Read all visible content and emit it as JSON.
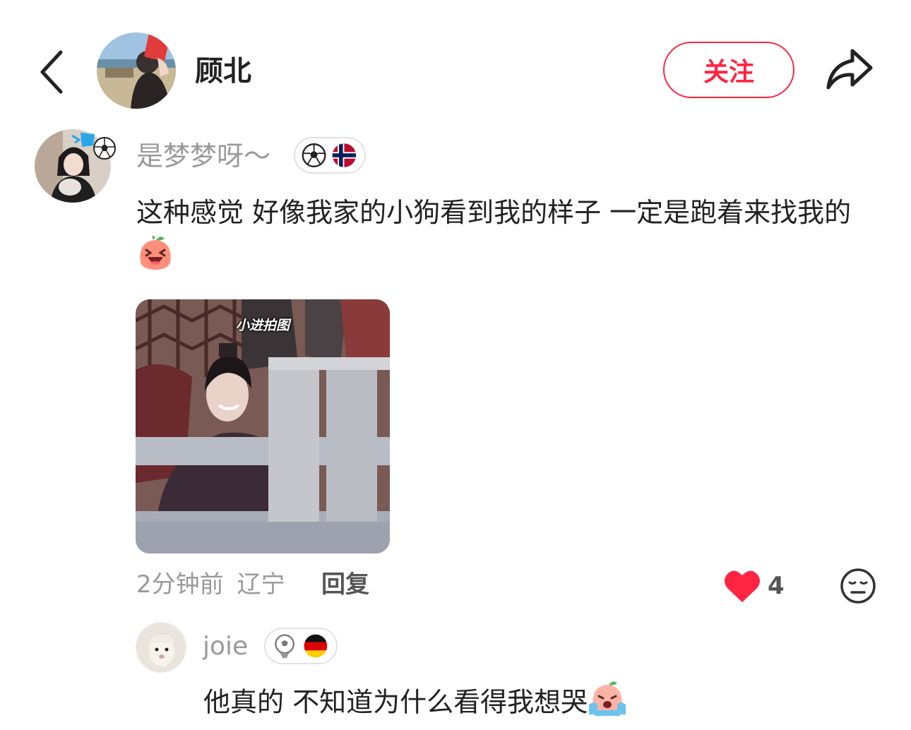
{
  "header": {
    "author_name": "顾北",
    "follow_label": "关注",
    "icons": {
      "back": "chevron-left-icon",
      "share": "share-arrow-icon"
    }
  },
  "comment": {
    "user_name": "是梦梦呀～",
    "text": "这种感觉 好像我家的小狗看到我的样子 一定是跑着来找我的",
    "text_emoji": "laughing-face-emoji",
    "badge_icons": [
      "soccer-ball-icon",
      "norway-flag-icon"
    ],
    "image_caption": "小进拍图",
    "time": "2分钟前",
    "location": "辽宁",
    "reply_label": "回复",
    "like_count": "4",
    "liked": true
  },
  "reply": {
    "user_name": "joie",
    "badge_icons": [
      "soccer-ball-icon",
      "germany-flag-icon"
    ],
    "text": "他真的 不知道为什么看得我想哭",
    "text_emoji": "crying-face-emoji"
  },
  "colors": {
    "accent": "#ff2442",
    "secondary_text": "#9a9a9a",
    "primary_text": "#222222"
  }
}
